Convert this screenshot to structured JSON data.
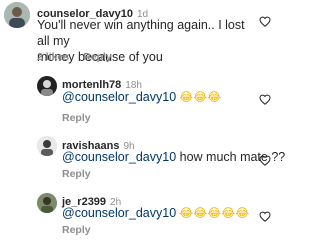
{
  "comments": [
    {
      "username": "counselor_davy10",
      "time": "1d",
      "text_line1": "You'll never win anything again.. I lost all my",
      "text_line2": "money because of you",
      "likes": "2 likes",
      "reply": "Reply"
    },
    {
      "username": "mortenlh78",
      "time": "18h",
      "mention": "@counselor_davy10",
      "suffix": "",
      "emojis": "😂😂😂",
      "reply": "Reply"
    },
    {
      "username": "ravishaans",
      "time": "9h",
      "mention": "@counselor_davy10",
      "suffix": " how much mate ??",
      "reply": "Reply"
    },
    {
      "username": "je_r2399",
      "time": "2h",
      "mention": "@counselor_davy10",
      "suffix": "",
      "emojis": "😂😂😂😂😂",
      "reply": "Reply"
    }
  ],
  "icons": {
    "like": "heart-outline-icon"
  },
  "colors": {
    "text": "#262626",
    "muted": "#8e8e8e",
    "mention": "#00376b"
  }
}
